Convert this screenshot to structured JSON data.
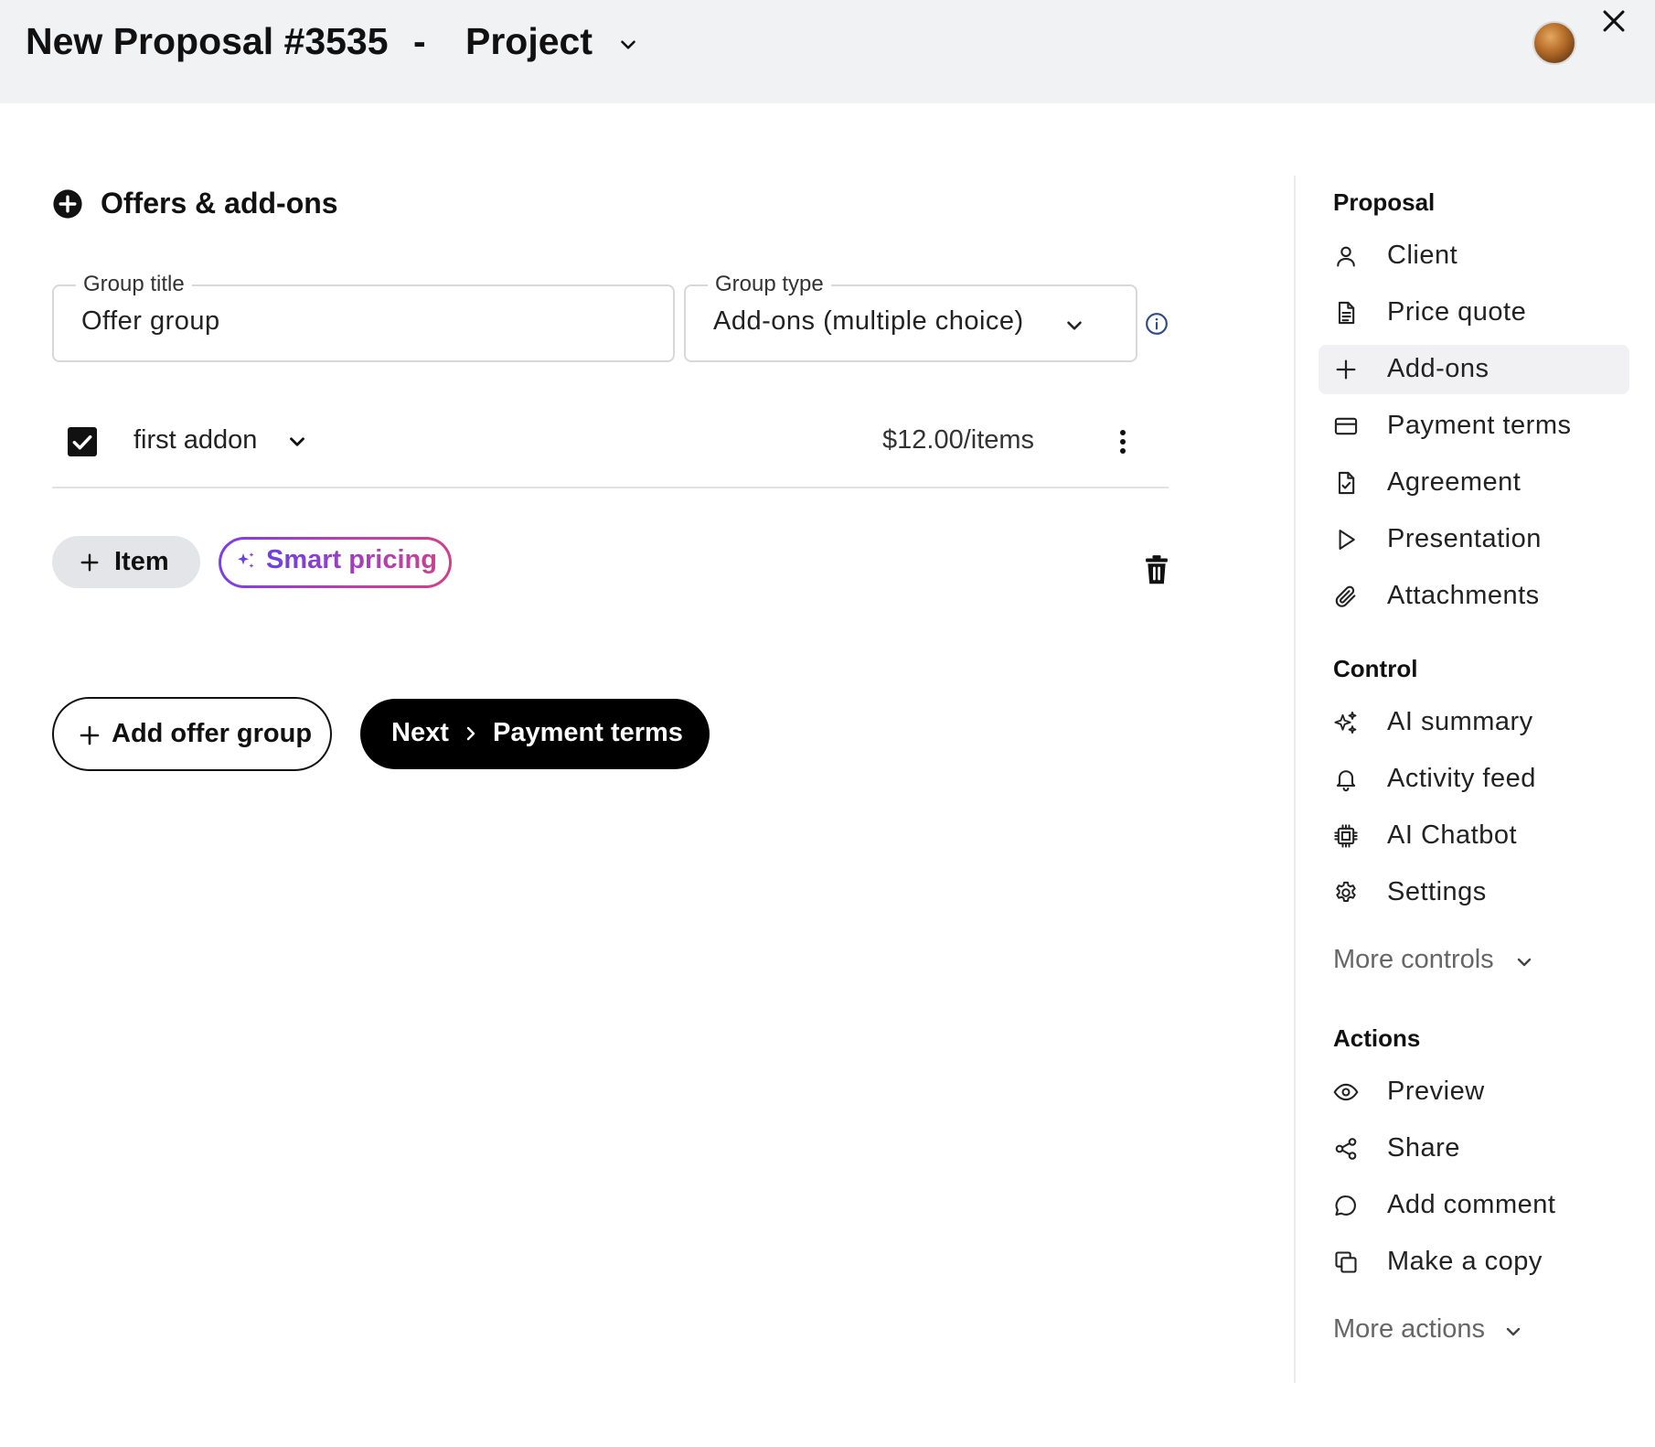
{
  "header": {
    "title": "New Proposal #3535",
    "separator": "-",
    "project": "Project"
  },
  "section": {
    "title": "Offers & add-ons"
  },
  "group_title": {
    "label": "Group title",
    "value": "Offer group"
  },
  "group_type": {
    "label": "Group type",
    "value": "Add-ons (multiple choice)"
  },
  "addon": {
    "name": "first addon",
    "price": "$12.00/items",
    "checked": true
  },
  "buttons": {
    "item": "Item",
    "smart_pricing": "Smart pricing",
    "add_offer_group": "Add offer group",
    "next": "Next",
    "next_target": "Payment terms"
  },
  "sidebar": {
    "proposal_heading": "Proposal",
    "proposal_items": [
      {
        "label": "Client",
        "icon": "user-icon"
      },
      {
        "label": "Price quote",
        "icon": "document-icon"
      },
      {
        "label": "Add-ons",
        "icon": "plus-icon",
        "active": true
      },
      {
        "label": "Payment terms",
        "icon": "credit-card-icon"
      },
      {
        "label": "Agreement",
        "icon": "document-check-icon"
      },
      {
        "label": "Presentation",
        "icon": "play-icon"
      },
      {
        "label": "Attachments",
        "icon": "paperclip-icon"
      }
    ],
    "control_heading": "Control",
    "control_items": [
      {
        "label": "AI summary",
        "icon": "sparkles-icon"
      },
      {
        "label": "Activity feed",
        "icon": "bell-icon"
      },
      {
        "label": "AI Chatbot",
        "icon": "chip-icon"
      },
      {
        "label": "Settings",
        "icon": "gear-icon"
      }
    ],
    "more_controls": "More controls",
    "actions_heading": "Actions",
    "action_items": [
      {
        "label": "Preview",
        "icon": "eye-icon"
      },
      {
        "label": "Share",
        "icon": "share-icon"
      },
      {
        "label": "Add comment",
        "icon": "comment-icon"
      },
      {
        "label": "Make a copy",
        "icon": "copy-icon"
      }
    ],
    "more_actions": "More actions"
  },
  "colors": {
    "header_bg": "#f1f2f4",
    "primary": "#000000",
    "smart_gradient_start": "#7b3fe4",
    "smart_gradient_end": "#d0408a",
    "info": "#2d4a8a"
  }
}
